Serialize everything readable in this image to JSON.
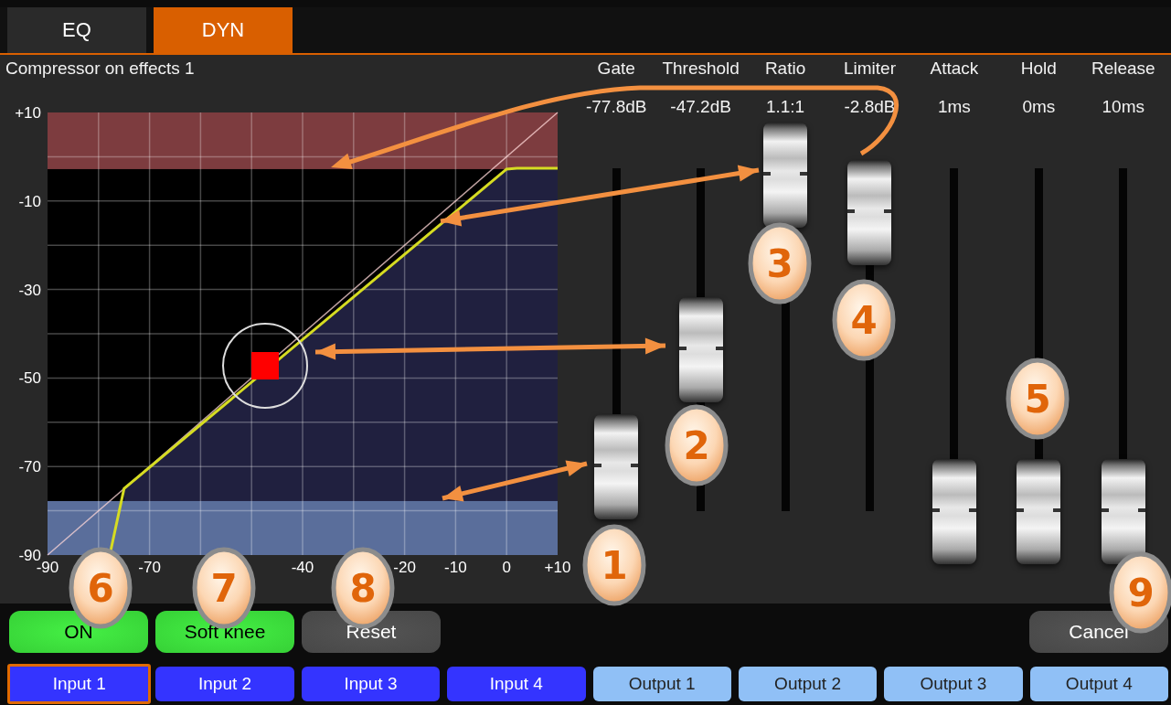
{
  "tabs": [
    {
      "label": "EQ",
      "selected": false
    },
    {
      "label": "DYN",
      "selected": true
    }
  ],
  "graph": {
    "title": "Compressor on effects 1",
    "y_ticks": [
      "+10",
      "-10",
      "-30",
      "-50",
      "-70",
      "-90"
    ],
    "x_ticks": [
      "-90",
      "-70",
      "-40",
      "-20",
      "-10",
      "0",
      "+10"
    ]
  },
  "faders": [
    {
      "name": "Gate",
      "value": "-77.8dB",
      "level": 0.13
    },
    {
      "name": "Threshold",
      "value": "-47.2dB",
      "level": 0.47
    },
    {
      "name": "Ratio",
      "value": "1.1:1",
      "level": 0.98
    },
    {
      "name": "Limiter",
      "value": "-2.8dB",
      "level": 0.87
    },
    {
      "name": "Attack",
      "value": "1ms",
      "level": 0
    },
    {
      "name": "Hold",
      "value": "0ms",
      "level": 0
    },
    {
      "name": "Release",
      "value": "10ms",
      "level": 0
    }
  ],
  "buttons": [
    {
      "label": "ON",
      "on": true
    },
    {
      "label": "Soft knee",
      "on": true
    },
    {
      "label": "Reset",
      "on": false
    }
  ],
  "cancel": {
    "label": "Cancel"
  },
  "channels": [
    {
      "label": "Input 1",
      "kind": "input",
      "selected": true
    },
    {
      "label": "Input 2",
      "kind": "input",
      "selected": false
    },
    {
      "label": "Input 3",
      "kind": "input",
      "selected": false
    },
    {
      "label": "Input 4",
      "kind": "input",
      "selected": false
    },
    {
      "label": "Output 1",
      "kind": "output",
      "selected": false
    },
    {
      "label": "Output 2",
      "kind": "output",
      "selected": false
    },
    {
      "label": "Output 3",
      "kind": "output",
      "selected": false
    },
    {
      "label": "Output 4",
      "kind": "output",
      "selected": false
    }
  ],
  "callouts": [
    "1",
    "2",
    "3",
    "4",
    "5",
    "6",
    "7",
    "8",
    "9"
  ]
}
